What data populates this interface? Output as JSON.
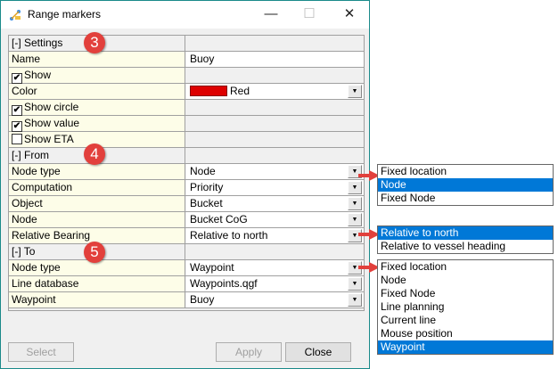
{
  "window": {
    "title": "Range markers",
    "icon": "range-markers-app-icon"
  },
  "settings": {
    "header": "[-] Settings",
    "badge": "3",
    "name_label": "Name",
    "name_value": "Buoy",
    "show_label": "Show",
    "show_checked": true,
    "color_label": "Color",
    "color_value": "Red",
    "color_swatch": "#dd0000",
    "show_circle_label": "Show circle",
    "show_circle_checked": true,
    "show_value_label": "Show value",
    "show_value_checked": true,
    "show_eta_label": "Show ETA",
    "show_eta_checked": false
  },
  "from": {
    "header": "[-] From",
    "badge": "4",
    "rows": [
      {
        "label": "Node type",
        "value": "Node"
      },
      {
        "label": "Computation",
        "value": "Priority"
      },
      {
        "label": "Object",
        "value": "Bucket"
      },
      {
        "label": "Node",
        "value": "Bucket CoG"
      },
      {
        "label": "Relative Bearing",
        "value": "Relative to north"
      }
    ]
  },
  "to": {
    "header": "[-] To",
    "badge": "5",
    "rows": [
      {
        "label": "Node type",
        "value": "Waypoint"
      },
      {
        "label": "Line database",
        "value": "Waypoints.qgf"
      },
      {
        "label": "Waypoint",
        "value": "Buoy"
      }
    ]
  },
  "buttons": {
    "select": "Select",
    "apply": "Apply",
    "close": "Close"
  },
  "popups": {
    "from_node_type": {
      "options": [
        "Fixed location",
        "Node",
        "Fixed Node"
      ],
      "selected": "Node"
    },
    "relative_bearing": {
      "options": [
        "Relative to north",
        "Relative to vessel heading"
      ],
      "selected": "Relative to north"
    },
    "to_node_type": {
      "options": [
        "Fixed location",
        "Node",
        "Fixed Node",
        "Line planning",
        "Current line",
        "Mouse position",
        "Waypoint"
      ],
      "selected": "Waypoint"
    }
  },
  "colors": {
    "accent": "#0078d7",
    "badge": "#e2403c",
    "label_bg": "#fdfde8",
    "window_border": "#1a8a8a"
  }
}
